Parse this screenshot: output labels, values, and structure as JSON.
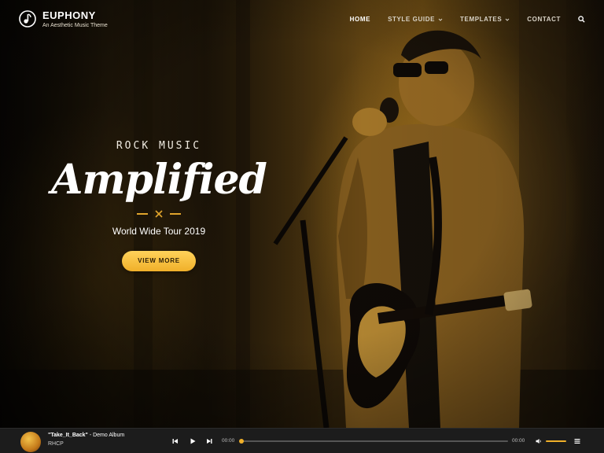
{
  "header": {
    "site_title": "EUPHONY",
    "tagline": "An Aesthetic Music Theme",
    "logo_icon": "music-note-icon"
  },
  "nav": {
    "items": [
      {
        "label": "HOME",
        "active": true,
        "has_dropdown": false
      },
      {
        "label": "STYLE GUIDE",
        "active": false,
        "has_dropdown": true
      },
      {
        "label": "TEMPLATES",
        "active": false,
        "has_dropdown": true
      },
      {
        "label": "CONTACT",
        "active": false,
        "has_dropdown": false
      }
    ],
    "search_icon": "search-icon"
  },
  "hero": {
    "eyebrow": "ROCK MUSIC",
    "headline": "Amplified",
    "subline": "World Wide Tour 2019",
    "cta_label": "VIEW MORE"
  },
  "player": {
    "track_title": "\"Take_It_Back\"",
    "album": " - Demo Album",
    "artist": "RHCP",
    "time_current": "00:00",
    "time_total": "00:00",
    "progress": 0,
    "volume": 1,
    "icons": [
      "prev-icon",
      "play-icon",
      "next-icon",
      "volume-icon",
      "playlist-icon"
    ]
  },
  "colors": {
    "accent": "#f0b02a",
    "player_bg": "#1c1c1c"
  }
}
